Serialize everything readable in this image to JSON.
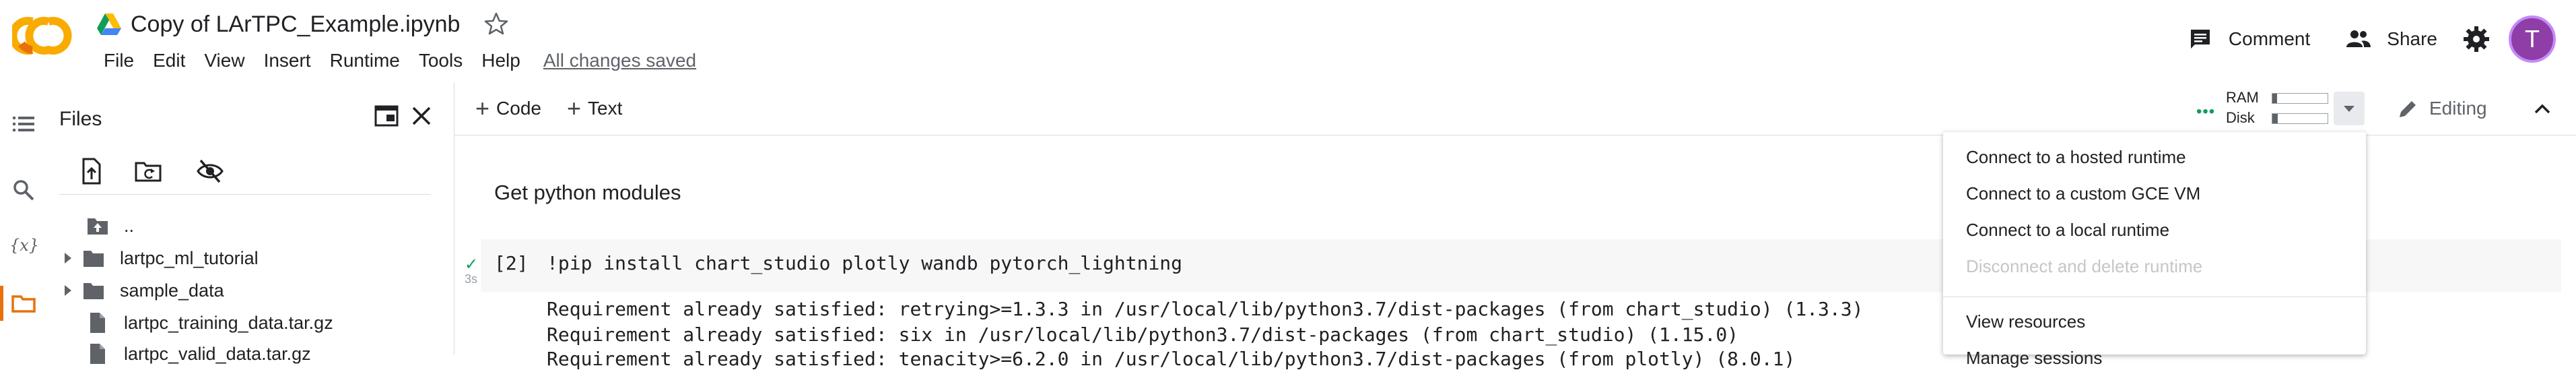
{
  "header": {
    "title": "Copy of LArTPC_Example.ipynb",
    "menu": [
      "File",
      "Edit",
      "View",
      "Insert",
      "Runtime",
      "Tools",
      "Help"
    ],
    "saved_status": "All changes saved",
    "comment_label": "Comment",
    "share_label": "Share",
    "avatar_letter": "T"
  },
  "toolbar": {
    "code_label": "Code",
    "text_label": "Text",
    "ram_label": "RAM",
    "disk_label": "Disk",
    "editing_label": "Editing"
  },
  "files_panel": {
    "title": "Files",
    "tree": [
      {
        "name": "..",
        "kind": "up-folder"
      },
      {
        "name": "lartpc_ml_tutorial",
        "kind": "folder"
      },
      {
        "name": "sample_data",
        "kind": "folder"
      },
      {
        "name": "lartpc_training_data.tar.gz",
        "kind": "file"
      },
      {
        "name": "lartpc_valid_data.tar.gz",
        "kind": "file"
      }
    ]
  },
  "notebook": {
    "section_heading": "Get python modules",
    "cell": {
      "exec_count": "[2]",
      "run_time": "3s",
      "code": "!pip install chart_studio plotly wandb pytorch_lightning",
      "output": [
        "Requirement already satisfied: retrying>=1.3.3 in /usr/local/lib/python3.7/dist-packages (from chart_studio) (1.3.3)",
        "Requirement already satisfied: six in /usr/local/lib/python3.7/dist-packages (from chart_studio) (1.15.0)",
        "Requirement already satisfied: tenacity>=6.2.0 in /usr/local/lib/python3.7/dist-packages (from plotly) (8.0.1)"
      ]
    }
  },
  "runtime_menu": {
    "items": [
      {
        "label": "Connect to a hosted runtime",
        "enabled": true
      },
      {
        "label": "Connect to a custom GCE VM",
        "enabled": true
      },
      {
        "label": "Connect to a local runtime",
        "enabled": true
      },
      {
        "label": "Disconnect and delete runtime",
        "enabled": false
      },
      {
        "label": "View resources",
        "enabled": true
      },
      {
        "label": "Manage sessions",
        "enabled": true
      }
    ]
  },
  "colors": {
    "accent_orange": "#e8710a",
    "logo_yellow": "#f9ab00",
    "avatar": "#8e3ea6",
    "success": "#0f9d58"
  },
  "usage": {
    "ram_fraction": 0.08,
    "disk_fraction": 0.1
  }
}
